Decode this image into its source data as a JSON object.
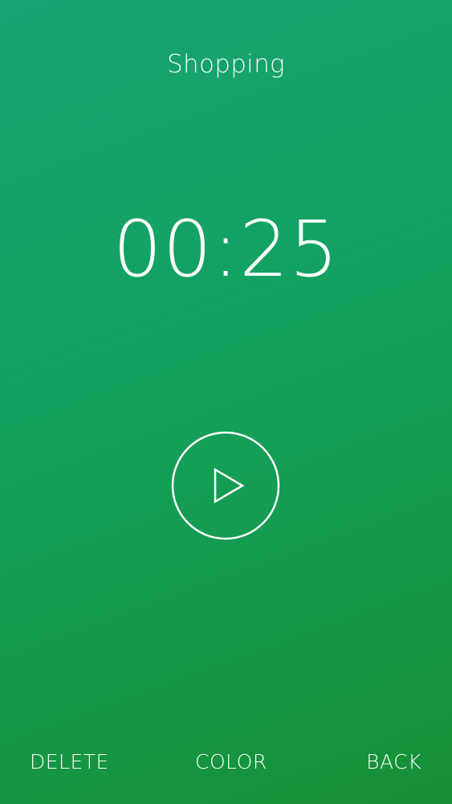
{
  "timer": {
    "title": "Shopping",
    "time": "00:25"
  },
  "controls": {
    "play_icon": "play-icon"
  },
  "bottom_bar": {
    "delete_label": "DELETE",
    "color_label": "COLOR",
    "back_label": "BACK"
  },
  "colors": {
    "background_top": "#17a372",
    "background_bottom": "#168f36",
    "foreground": "#ffffff"
  }
}
